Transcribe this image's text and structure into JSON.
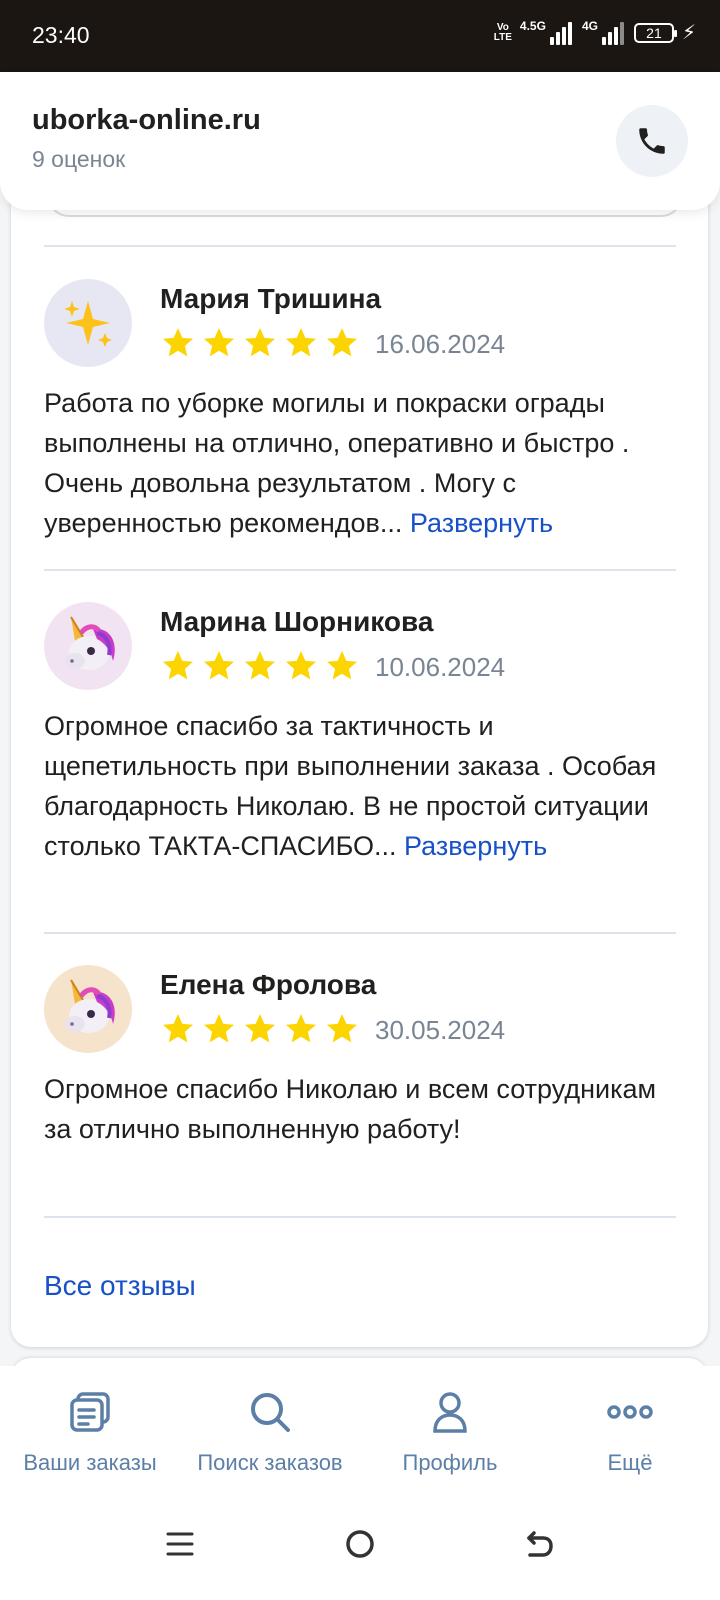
{
  "status_bar": {
    "time": "23:40",
    "volte_top": "Vo",
    "volte_bottom": "LTE",
    "net1": "4.5G",
    "net2": "4G",
    "battery": "21"
  },
  "header": {
    "site": "uborka-online.ru",
    "rating_count": "9 оценок",
    "call_icon": "phone-icon"
  },
  "reviews": [
    {
      "author": "Мария Тришина",
      "avatar_icon": "sparkles-icon",
      "avatar_bg": "#e6e7f3",
      "stars": 5,
      "date": "16.06.2024",
      "text": "Работа по уборке могилы и покраски ограды выполнены на отлично, оперативно и быстро . Очень довольна результатом . Могу с уверенностью рекомендов...",
      "expand_label": "Развернуть"
    },
    {
      "author": "Марина Шорникова",
      "avatar_icon": "unicorn-icon",
      "avatar_bg": "#f1e3f1",
      "stars": 5,
      "date": "10.06.2024",
      "text": "Огромное спасибо за тактичность и щепетильность при выполнении заказа . Особая благодарность Николаю. В не простой ситуации столько ТАКТА-СПАСИБО...",
      "expand_label": "Развернуть"
    },
    {
      "author": "Елена Фролова",
      "avatar_icon": "unicorn-icon",
      "avatar_bg": "#f5e3cc",
      "stars": 5,
      "date": "30.05.2024",
      "text": "Огромное спасибо Николаю и всем сотрудникам за отлично выполненную работу!"
    }
  ],
  "all_reviews_label": "Все отзывы",
  "bottom_nav": [
    {
      "label": "Ваши заказы",
      "icon": "orders-icon"
    },
    {
      "label": "Поиск заказов",
      "icon": "search-icon"
    },
    {
      "label": "Профиль",
      "icon": "profile-icon"
    },
    {
      "label": "Ещё",
      "icon": "more-icon"
    }
  ],
  "colors": {
    "star": "#fcd500",
    "link": "#1850c8",
    "nav": "#5b7fa6"
  }
}
